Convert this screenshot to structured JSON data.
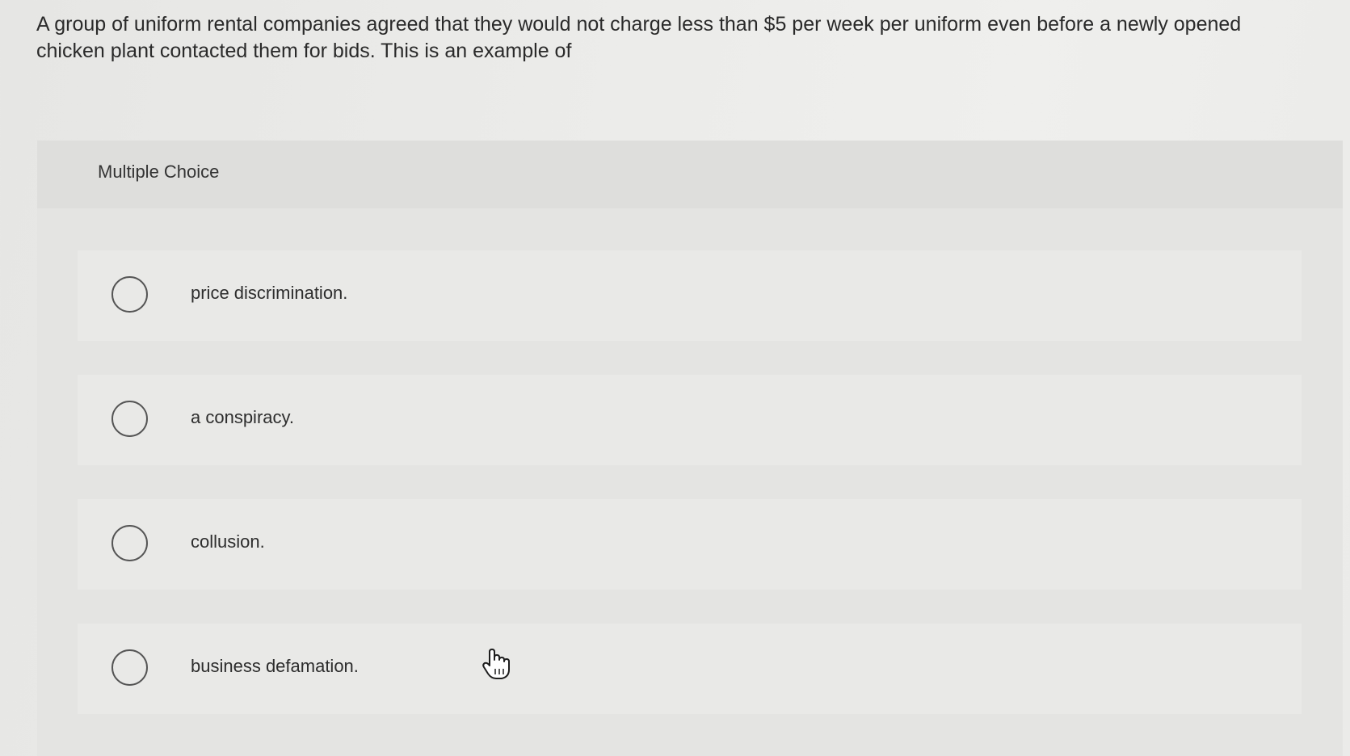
{
  "question": {
    "text": "A group of uniform rental companies agreed that they would not charge less than $5 per week per uniform even before a newly opened chicken plant contacted them for bids. This is an example of"
  },
  "multiple_choice": {
    "header_label": "Multiple Choice",
    "options": [
      {
        "label": "price discrimination.",
        "selected": false
      },
      {
        "label": "a conspiracy.",
        "selected": false
      },
      {
        "label": "collusion.",
        "selected": false
      },
      {
        "label": "business defamation.",
        "selected": false
      }
    ]
  },
  "cursor": {
    "icon": "hand-pointer-icon"
  }
}
